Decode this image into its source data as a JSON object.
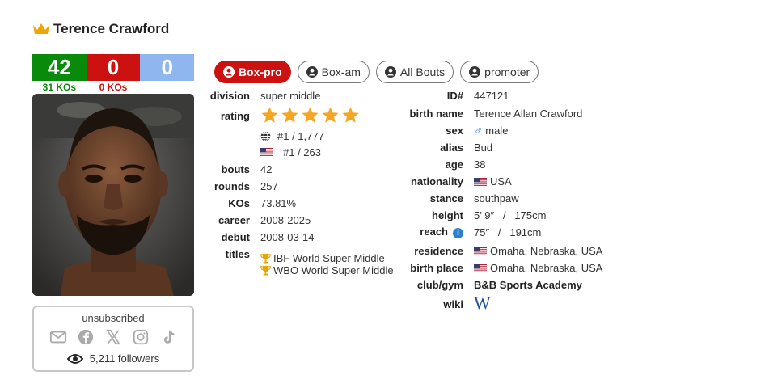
{
  "header": {
    "name": "Terence Crawford",
    "crown_icon": "crown-icon"
  },
  "record": {
    "wins": "42",
    "losses": "0",
    "draws": "0",
    "wins_kos": "31 KOs",
    "losses_kos": "0 KOs"
  },
  "social": {
    "status": "unsubscribed",
    "followers": "5,211 followers",
    "icons": [
      "mail-icon",
      "facebook-icon",
      "x-icon",
      "instagram-icon",
      "tiktok-icon",
      "eye-icon"
    ]
  },
  "tabs": [
    {
      "label": "Box-pro",
      "active": true
    },
    {
      "label": "Box-am",
      "active": false
    },
    {
      "label": "All Bouts",
      "active": false
    },
    {
      "label": "promoter",
      "active": false
    }
  ],
  "left_info": {
    "division_label": "division",
    "division": "super middle",
    "rating_label": "rating",
    "rating_stars": 5,
    "world_rank": "#1 / 1,777",
    "usa_rank": "#1 / 263",
    "bouts_label": "bouts",
    "bouts": "42",
    "rounds_label": "rounds",
    "rounds": "257",
    "kos_label": "KOs",
    "kos": "73.81%",
    "career_label": "career",
    "career": "2008-2025",
    "debut_label": "debut",
    "debut": "2008-03-14",
    "titles_label": "titles",
    "titles": [
      "IBF World Super Middle",
      "WBO World Super Middle"
    ]
  },
  "right_info": {
    "id_label": "ID#",
    "id": "447121",
    "birth_name_label": "birth name",
    "birth_name": "Terence Allan Crawford",
    "sex_label": "sex",
    "sex": "male",
    "alias_label": "alias",
    "alias": "Bud",
    "age_label": "age",
    "age": "38",
    "nationality_label": "nationality",
    "nationality": "USA",
    "stance_label": "stance",
    "stance": "southpaw",
    "height_label": "height",
    "height": "5′ 9″   /   175cm",
    "reach_label": "reach",
    "reach": "75″   /   191cm",
    "residence_label": "residence",
    "residence": "Omaha, Nebraska, USA",
    "birth_place_label": "birth place",
    "birth_place": "Omaha, Nebraska, USA",
    "club_label": "club/gym",
    "club": "B&B Sports Academy",
    "wiki_label": "wiki",
    "wiki_icon": "W"
  },
  "colors": {
    "win": "#0a8a0a",
    "loss": "#cc1111",
    "draw": "#8fb6ee",
    "star": "#f5a623",
    "accent": "#2a7fd4"
  }
}
